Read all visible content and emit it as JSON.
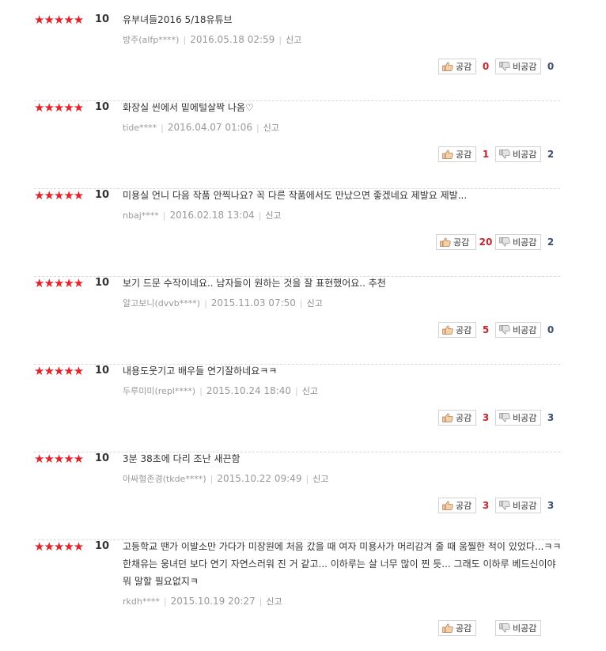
{
  "labels": {
    "like": "공감",
    "dislike": "비공감",
    "report": "신고"
  },
  "icons": {
    "star": "star-icon",
    "like": "thumbs-up-icon",
    "dislike": "thumbs-down-icon"
  },
  "colors": {
    "star": "#e4222a",
    "like_count": "#c4242b",
    "dislike_count": "#3e4b6f"
  },
  "reviews": [
    {
      "stars": "★★★★★",
      "score": "10",
      "text": "유부녀들2016 5/18유튜브",
      "user": "방주(alfp****)",
      "date": "2016.05.18 02:59",
      "likes": "0",
      "dislikes": "0"
    },
    {
      "stars": "★★★★★",
      "score": "10",
      "text": "화장실 씬에서 밑에털살짝 나옴♡",
      "user": "tide****",
      "date": "2016.04.07 01:06",
      "likes": "1",
      "dislikes": "2"
    },
    {
      "stars": "★★★★★",
      "score": "10",
      "text": "미용실 언니 다음 작품 안찍나요? 꼭 다른 작품에서도 만났으면 좋겠네요 제발요 제발...",
      "user": "nbaj****",
      "date": "2016.02.18 13:04",
      "likes": "20",
      "dislikes": "2"
    },
    {
      "stars": "★★★★★",
      "score": "10",
      "text": "보기 드문 수작이네요.. 남자들이 원하는 것을 잘 표현했어요.. 추천",
      "user": "알고보니(dvvb****)",
      "date": "2015.11.03 07:50",
      "likes": "5",
      "dislikes": "0"
    },
    {
      "stars": "★★★★★",
      "score": "10",
      "text": "내용도웃기고 배우들 연기잘하네요ㅋㅋ",
      "user": "두루미미(repl****)",
      "date": "2015.10.24 18:40",
      "likes": "3",
      "dislikes": "3"
    },
    {
      "stars": "★★★★★",
      "score": "10",
      "text": "3분 38초에 다리 조난 새끈함",
      "user": "아싸형존경(tkde****)",
      "date": "2015.10.22 09:49",
      "likes": "3",
      "dislikes": "3"
    },
    {
      "stars": "★★★★★",
      "score": "10",
      "text": "고등학교 땐가 이발소만 가다가 미장원에 처음 갔을 때 여자 미용사가 머리감겨 줄 때 움찔한 적이 있었다...ㅋㅋ 한채유는 웅녀던 보다 연기 자연스러워 진 거 같고... 이하루는 살 너무 많이 찐 듯... 그래도 이하루 베드신이야 뭐 말할 필요없지ㅋ",
      "user": "rkdh****",
      "date": "2015.10.19 20:27",
      "likes": "",
      "dislikes": ""
    }
  ]
}
